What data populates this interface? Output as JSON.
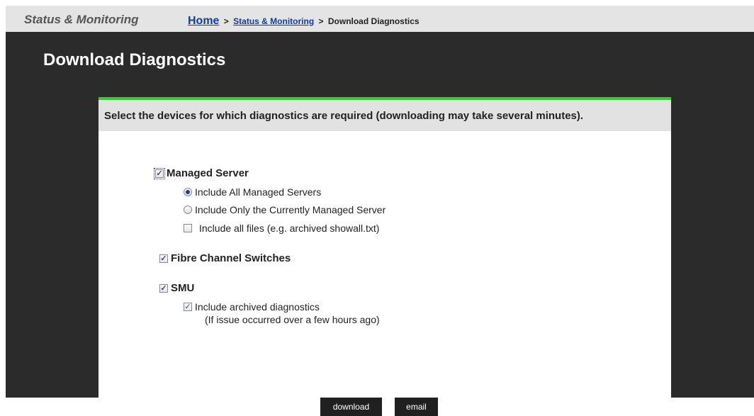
{
  "header": {
    "section_name": "Status & Monitoring",
    "breadcrumb": {
      "home": "Home",
      "separator": ">",
      "link": "Status & Monitoring",
      "current": "Download Diagnostics"
    }
  },
  "page_title": "Download Diagnostics",
  "panel": {
    "instruction": "Select the devices for which diagnostics are required (downloading may take several minutes).",
    "managed_server": {
      "label": "Managed Server",
      "checked": true,
      "radio_all": "Include All Managed Servers",
      "radio_all_selected": true,
      "radio_current": "Include Only the Currently Managed Server",
      "include_all_files": "Include all files (e.g. archived showall.txt)",
      "include_all_files_checked": false
    },
    "fibre_channel": {
      "label": "Fibre Channel Switches",
      "checked": true
    },
    "smu": {
      "label": "SMU",
      "checked": true,
      "include_archived": "Include archived diagnostics",
      "include_archived_checked": true,
      "include_archived_note": "(If issue occurred over a few hours ago)"
    }
  },
  "buttons": {
    "download": "download",
    "email": "email"
  },
  "colors": {
    "accent": "#33cc33",
    "dark_bg": "#2b2b2b",
    "link": "#0a3fa0"
  }
}
